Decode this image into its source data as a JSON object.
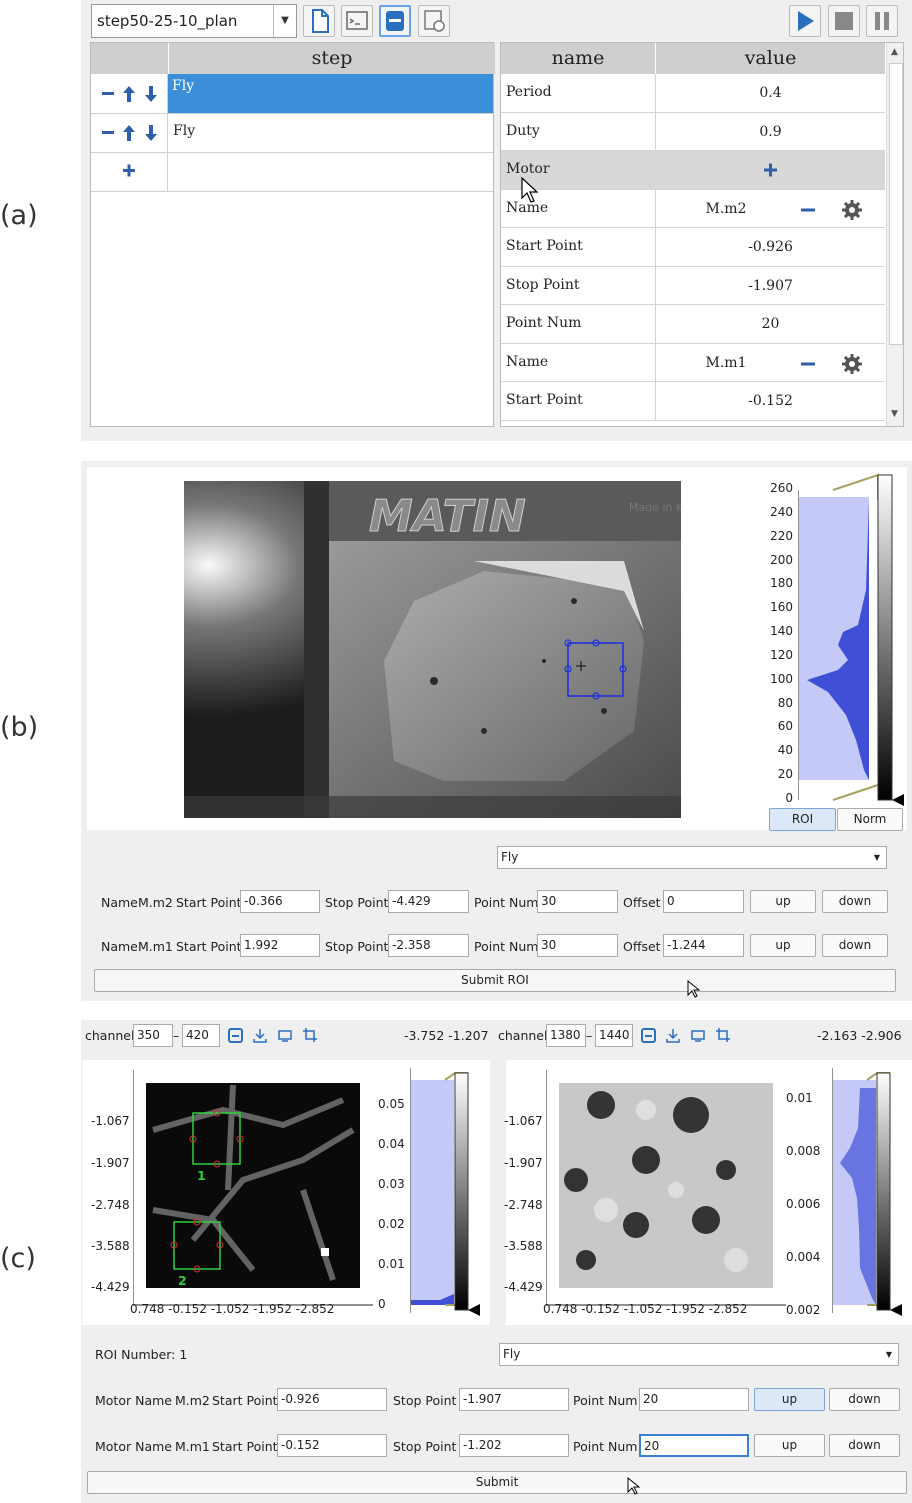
{
  "labels": {
    "a": "(a)",
    "b": "(b)",
    "c": "(c)"
  },
  "plan": {
    "name": "step50-25-10_plan"
  },
  "steps": {
    "header": "step",
    "items": [
      "Fly",
      "Fly"
    ]
  },
  "params": {
    "col_name": "name",
    "col_value": "value",
    "rows": [
      {
        "name": "Period",
        "value": "0.4"
      },
      {
        "name": "Duty",
        "value": "0.9"
      },
      {
        "name": "Motor",
        "value": ""
      },
      {
        "name": "Name",
        "value": "M.m2"
      },
      {
        "name": "Start Point",
        "value": "-0.926"
      },
      {
        "name": "Stop Point",
        "value": "-1.907"
      },
      {
        "name": "Point Num",
        "value": "20"
      },
      {
        "name": "Name",
        "value": "M.m1"
      },
      {
        "name": "Start Point",
        "value": "-0.152"
      }
    ]
  },
  "hist_b": {
    "ticks": [
      "260",
      "240",
      "220",
      "200",
      "180",
      "160",
      "140",
      "120",
      "100",
      "80",
      "60",
      "40",
      "20",
      "0"
    ],
    "roi": "ROI",
    "norm": "Norm"
  },
  "camera": {
    "logo": "MATIN",
    "made_in": "Made in Korea"
  },
  "roi_b": {
    "mode": "Fly",
    "rows": [
      {
        "name_lbl": "Name",
        "name": "M.m2",
        "start_lbl": "Start Point",
        "start": "-0.366",
        "stop_lbl": "Stop Point",
        "stop": "-4.429",
        "num_lbl": "Point Num",
        "num": "30",
        "off_lbl": "Offset",
        "off": "0",
        "up": "up",
        "down": "down"
      },
      {
        "name_lbl": "Name",
        "name": "M.m1",
        "start_lbl": "Start Point",
        "start": "1.992",
        "stop_lbl": "Stop Point",
        "stop": "-2.358",
        "num_lbl": "Point Num",
        "num": "30",
        "off_lbl": "Offset",
        "off": "-1.244",
        "up": "up",
        "down": "down"
      }
    ],
    "submit": "Submit ROI"
  },
  "channels": [
    {
      "label": "channel",
      "from": "350",
      "dash": "–",
      "to": "420",
      "coords": "-3.752 -1.207",
      "yticks": [
        "-1.067",
        "-1.907",
        "-2.748",
        "-3.588",
        "-4.429"
      ],
      "xticks": "0.748 -0.152 -1.052 -1.952 -2.852",
      "cticks": [
        "0.05",
        "0.04",
        "0.03",
        "0.02",
        "0.01",
        "0"
      ],
      "roi_labels": [
        "1",
        "2"
      ]
    },
    {
      "label": "channel",
      "from": "1380",
      "dash": "–",
      "to": "1440",
      "coords": "-2.163 -2.906",
      "yticks": [
        "-1.067",
        "-1.907",
        "-2.748",
        "-3.588",
        "-4.429"
      ],
      "xticks": "0.748 -0.152 -1.052 -1.952 -2.852",
      "cticks": [
        "0.01",
        "0.008",
        "0.006",
        "0.004",
        "0.002"
      ]
    }
  ],
  "roi_c": {
    "number": "ROI Number: 1",
    "mode": "Fly",
    "rows": [
      {
        "name_lbl": "Motor Name",
        "name": "M.m2",
        "start_lbl": "Start Point",
        "start": "-0.926",
        "stop_lbl": "Stop Point",
        "stop": "-1.907",
        "num_lbl": "Point Num",
        "num": "20",
        "up": "up",
        "down": "down"
      },
      {
        "name_lbl": "Motor Name",
        "name": "M.m1",
        "start_lbl": "Start Point",
        "start": "-0.152",
        "stop_lbl": "Stop Point",
        "stop": "-1.202",
        "num_lbl": "Point Num",
        "num": "20",
        "up": "up",
        "down": "down"
      }
    ],
    "submit": "Submit"
  },
  "colors": {
    "accent": "#3c7fd0",
    "selection": "#3b8fd9",
    "hist": "#c5c9f7",
    "hist_dark": "#4050d6"
  }
}
